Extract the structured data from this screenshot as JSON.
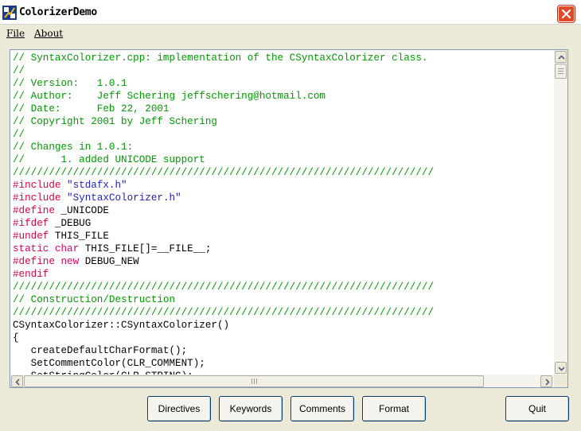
{
  "window": {
    "title": "ColorizerDemo",
    "icon": "app-icon",
    "close_icon": "close-icon"
  },
  "menu": {
    "items": [
      {
        "label": "File"
      },
      {
        "label": "About"
      }
    ]
  },
  "editor": {
    "lines": [
      [
        [
          "comment",
          "// SyntaxColorizer.cpp: implementation of the CSyntaxColorizer class."
        ]
      ],
      [
        [
          "comment",
          "//"
        ]
      ],
      [
        [
          "comment",
          "// Version:   1.0.1"
        ]
      ],
      [
        [
          "comment",
          "// Author:    Jeff Schering jeffschering@hotmail.com"
        ]
      ],
      [
        [
          "comment",
          "// Date:      Feb 22, 2001"
        ]
      ],
      [
        [
          "comment",
          "// Copyright 2001 by Jeff Schering"
        ]
      ],
      [
        [
          "comment",
          "//"
        ]
      ],
      [
        [
          "comment",
          "// Changes in 1.0.1:"
        ]
      ],
      [
        [
          "comment",
          "//      1. added UNICODE support"
        ]
      ],
      [
        [
          "comment",
          "//////////////////////////////////////////////////////////////////////"
        ]
      ],
      [
        [
          "directive",
          "#include "
        ],
        [
          "string",
          "\"stdafx.h\""
        ]
      ],
      [
        [
          "directive",
          "#include "
        ],
        [
          "string",
          "\"SyntaxColorizer.h\""
        ]
      ],
      [
        [
          "directive",
          "#define "
        ],
        [
          "normal",
          "_UNICODE"
        ]
      ],
      [
        [
          "directive",
          "#ifdef "
        ],
        [
          "normal",
          "_DEBUG"
        ]
      ],
      [
        [
          "directive",
          "#undef "
        ],
        [
          "normal",
          "THIS_FILE"
        ]
      ],
      [
        [
          "keyword",
          "static "
        ],
        [
          "keyword",
          "char "
        ],
        [
          "normal",
          "THIS_FILE[]=__FILE__;"
        ]
      ],
      [
        [
          "directive",
          "#define "
        ],
        [
          "keyword",
          "new "
        ],
        [
          "normal",
          "DEBUG_NEW"
        ]
      ],
      [
        [
          "directive",
          "#endif"
        ]
      ],
      [
        [
          "comment",
          "//////////////////////////////////////////////////////////////////////"
        ]
      ],
      [
        [
          "comment",
          "// Construction/Destruction"
        ]
      ],
      [
        [
          "comment",
          "//////////////////////////////////////////////////////////////////////"
        ]
      ],
      [
        [
          "normal",
          "CSyntaxColorizer::CSyntaxColorizer()"
        ]
      ],
      [
        [
          "normal",
          "{"
        ]
      ],
      [
        [
          "normal",
          "   createDefaultCharFormat();"
        ]
      ],
      [
        [
          "normal",
          "   SetCommentColor(CLR_COMMENT);"
        ]
      ],
      [
        [
          "normal",
          "   SetStringColor(CLR_STRING);"
        ]
      ]
    ],
    "colors": {
      "comment": "#009900",
      "directive": "#dd0044",
      "string": "#2222bb",
      "keyword": "#dd0066",
      "normal": "#000000"
    }
  },
  "scrollbars": {
    "up_icon": "arrow-up-icon",
    "down_icon": "arrow-down-icon",
    "left_icon": "arrow-left-icon",
    "right_icon": "arrow-right-icon"
  },
  "buttons": {
    "directives": "Directives",
    "keywords": "Keywords",
    "comments": "Comments",
    "format": "Format",
    "quit": "Quit"
  }
}
